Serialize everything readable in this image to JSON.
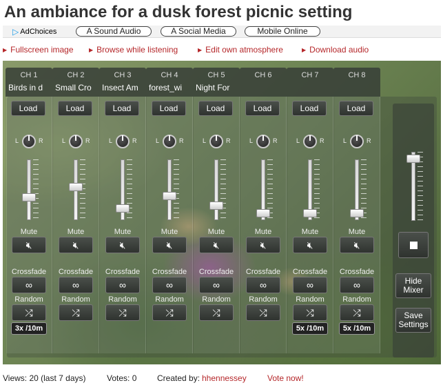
{
  "page_title": "An ambiance for a dusk forest picnic setting",
  "ad_bar": {
    "ad_choices": "AdChoices",
    "links": [
      "A Sound Audio",
      "A Social Media",
      "Mobile Online"
    ]
  },
  "actions": [
    "Fullscreen image",
    "Browse while listening",
    "Edit own atmosphere",
    "Download audio"
  ],
  "mixer": {
    "labels": {
      "load": "Load",
      "mute": "Mute",
      "crossfade": "Crossfade",
      "random": "Random",
      "left": "L",
      "right": "R"
    },
    "channels": [
      {
        "num": "CH 1",
        "name": "Birds in d",
        "volume": 0.35,
        "mute_dot": "none",
        "cross_dot": "none",
        "random_dot": "green",
        "random_badge": "3x /10m"
      },
      {
        "num": "CH 2",
        "name": "Small Cro",
        "volume": 0.55,
        "mute_dot": "none",
        "cross_dot": "green",
        "random_dot": "none",
        "random_badge": ""
      },
      {
        "num": "CH 3",
        "name": "Insect Am",
        "volume": 0.15,
        "mute_dot": "red",
        "cross_dot": "none",
        "random_dot": "none",
        "random_badge": ""
      },
      {
        "num": "CH 4",
        "name": "forest_wi",
        "volume": 0.38,
        "mute_dot": "none",
        "cross_dot": "none",
        "random_dot": "none",
        "random_badge": ""
      },
      {
        "num": "CH 5",
        "name": "Night For",
        "volume": 0.2,
        "mute_dot": "red",
        "cross_dot": "green",
        "random_dot": "none",
        "random_badge": ""
      },
      {
        "num": "CH 6",
        "name": "",
        "volume": 0.05,
        "mute_dot": "none",
        "cross_dot": "green",
        "random_dot": "none",
        "random_badge": ""
      },
      {
        "num": "CH 7",
        "name": "",
        "volume": 0.05,
        "mute_dot": "none",
        "cross_dot": "none",
        "random_dot": "green",
        "random_badge": "5x /10m"
      },
      {
        "num": "CH 8",
        "name": "",
        "volume": 0.05,
        "mute_dot": "red",
        "cross_dot": "none",
        "random_dot": "green",
        "random_badge": "5x /10m"
      }
    ],
    "master": {
      "volume": 0.95,
      "hide_mixer": "Hide Mixer",
      "save_settings": "Save Settings"
    }
  },
  "footer": {
    "views": "Views: 20 (last 7 days)",
    "votes": "Votes: 0",
    "created_by_label": "Created by:",
    "creator": "hhennessey",
    "vote_now": "Vote now!"
  },
  "colors": {
    "link_red": "#b5272a",
    "adchoices_blue": "#1a9be8"
  }
}
